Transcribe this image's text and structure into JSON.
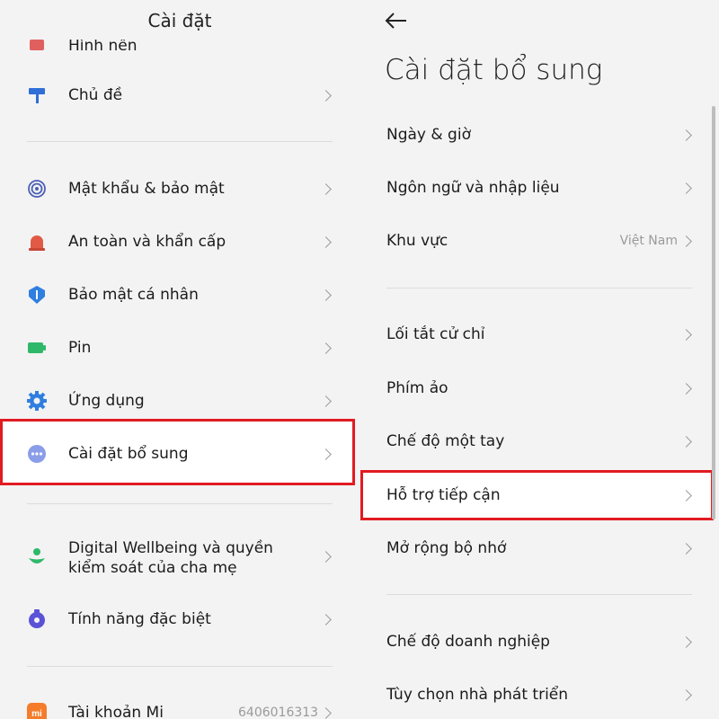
{
  "left": {
    "title": "Cài đặt",
    "partial_item": "Hình nền",
    "items_group1": [
      {
        "label": "Chủ đề",
        "icon": "paint-roller-icon",
        "color": "#2f6fd6"
      }
    ],
    "items_group2": [
      {
        "label": "Mật khẩu & bảo mật",
        "icon": "fingerprint-icon",
        "color": "#4a5fb6"
      },
      {
        "label": "An toàn và khẩn cấp",
        "icon": "emergency-light-icon",
        "color": "#e05a45"
      },
      {
        "label": "Bảo mật cá nhân",
        "icon": "privacy-shield-icon",
        "color": "#2f7fe0"
      },
      {
        "label": "Pin",
        "icon": "battery-icon",
        "color": "#2fb86a"
      },
      {
        "label": "Ứng dụng",
        "icon": "gear-icon",
        "color": "#2f7fe0"
      },
      {
        "label": "Cài đặt bổ sung",
        "icon": "more-dots-icon",
        "color": "#8a9de8"
      }
    ],
    "items_group3": [
      {
        "label": "Digital Wellbeing và quyền kiểm soát của cha mẹ",
        "icon": "wellbeing-icon",
        "color": "#2fb86a"
      },
      {
        "label": "Tính năng đặc biệt",
        "icon": "special-features-icon",
        "color": "#5b52d6"
      }
    ],
    "account": {
      "label": "Tài khoản Mi",
      "value": "6406016313",
      "icon": "mi-logo-icon",
      "color": "#f57c2a"
    }
  },
  "right": {
    "title": "Cài đặt bổ sung",
    "group1": [
      {
        "label": "Ngày & giờ",
        "value": ""
      },
      {
        "label": "Ngôn ngữ và nhập liệu",
        "value": ""
      },
      {
        "label": "Khu vực",
        "value": "Việt Nam"
      }
    ],
    "group2": [
      {
        "label": "Lối tắt cử chỉ"
      },
      {
        "label": "Phím ảo"
      },
      {
        "label": "Chế độ một tay"
      },
      {
        "label": "Hỗ trợ tiếp cận"
      },
      {
        "label": "Mở rộng bộ nhớ"
      }
    ],
    "group3": [
      {
        "label": "Chế độ doanh nghiệp"
      },
      {
        "label": "Tùy chọn nhà phát triển"
      }
    ]
  },
  "colors": {
    "highlight": "#e11b22",
    "panel_bg": "#f3f3f3"
  }
}
